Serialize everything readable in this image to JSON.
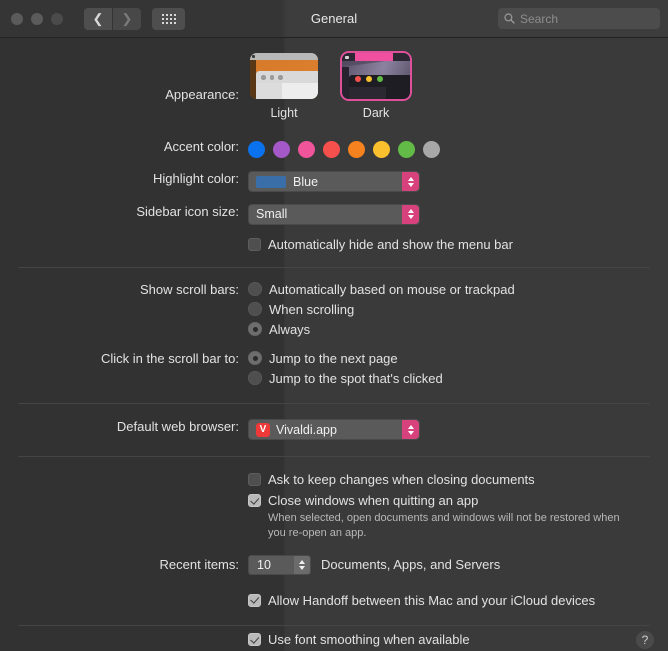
{
  "window": {
    "title": "General",
    "traffic_lights": [
      "close",
      "minimize",
      "zoom"
    ]
  },
  "toolbar": {
    "back_icon": "chevron-left-icon",
    "forward_icon": "chevron-right-icon",
    "grid_icon": "grid-view-icon",
    "search_placeholder": "Search",
    "search_value": ""
  },
  "appearance": {
    "label": "Appearance:",
    "options": [
      {
        "id": "light",
        "label": "Light",
        "selected": false
      },
      {
        "id": "dark",
        "label": "Dark",
        "selected": true
      }
    ]
  },
  "accent_color": {
    "label": "Accent color:",
    "selected": "pink",
    "swatches": [
      {
        "name": "blue",
        "hex": "#0a72ee"
      },
      {
        "name": "purple",
        "hex": "#a558c8"
      },
      {
        "name": "pink",
        "hex": "#f0549b"
      },
      {
        "name": "red",
        "hex": "#f6504d"
      },
      {
        "name": "orange",
        "hex": "#f5821f"
      },
      {
        "name": "yellow",
        "hex": "#fbc02d"
      },
      {
        "name": "green",
        "hex": "#62bb46"
      },
      {
        "name": "graphite",
        "hex": "#a8a8a8"
      }
    ]
  },
  "highlight_color": {
    "label": "Highlight color:",
    "value": "Blue",
    "swatch_hex": "#3a6ea8"
  },
  "sidebar_icon_size": {
    "label": "Sidebar icon size:",
    "value": "Small"
  },
  "menu_bar": {
    "label": "Automatically hide and show the menu bar",
    "checked": false
  },
  "scroll_bars": {
    "label": "Show scroll bars:",
    "options": [
      {
        "label": "Automatically based on mouse or trackpad",
        "selected": false
      },
      {
        "label": "When scrolling",
        "selected": false
      },
      {
        "label": "Always",
        "selected": true
      }
    ]
  },
  "scroll_click": {
    "label": "Click in the scroll bar to:",
    "options": [
      {
        "label": "Jump to the next page",
        "selected": true
      },
      {
        "label": "Jump to the spot that's clicked",
        "selected": false
      }
    ]
  },
  "default_browser": {
    "label": "Default web browser:",
    "value": "Vivaldi.app",
    "icon_glyph": "V",
    "icon_hex": "#ef3939"
  },
  "documents": {
    "ask_keep_changes": {
      "label": "Ask to keep changes when closing documents",
      "checked": false
    },
    "close_windows": {
      "label": "Close windows when quitting an app",
      "checked": true
    },
    "close_windows_help": "When selected, open documents and windows will not be restored when you re-open an app."
  },
  "recent_items": {
    "label": "Recent items:",
    "value": "10",
    "suffix": "Documents, Apps, and Servers"
  },
  "handoff": {
    "label": "Allow Handoff between this Mac and your iCloud devices",
    "checked": true
  },
  "font_smoothing": {
    "label": "Use font smoothing when available",
    "checked": true
  },
  "help": {
    "glyph": "?"
  }
}
